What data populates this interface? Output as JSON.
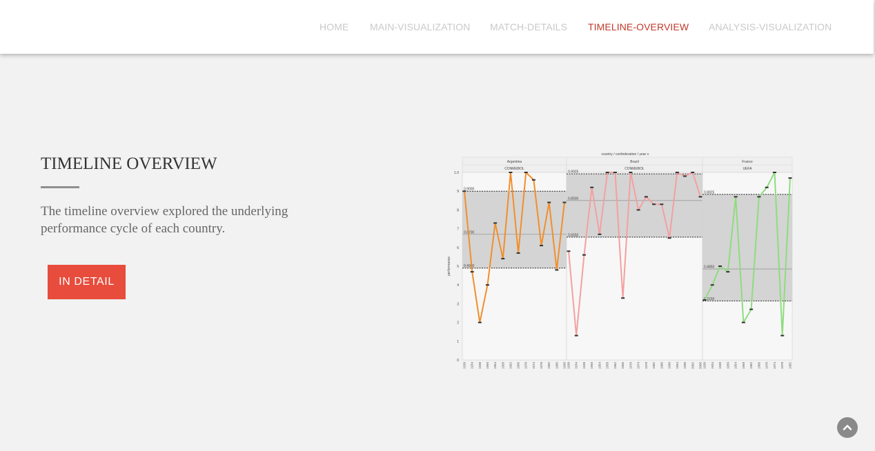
{
  "nav": {
    "items": [
      {
        "label": "HOME",
        "active": false
      },
      {
        "label": "MAIN-VISUALIZATION",
        "active": false
      },
      {
        "label": "MATCH-DETAILS",
        "active": false
      },
      {
        "label": "TIMELINE-OVERVIEW",
        "active": true
      },
      {
        "label": "ANALYSIS-VISUALIZATION",
        "active": false
      }
    ]
  },
  "section": {
    "title": "TIMELINE OVERVIEW",
    "description": "The timeline overview explored the underlying performance cycle of each country.",
    "button_label": "IN DETAIL"
  },
  "colors": {
    "accent": "#e74c3c",
    "nav_active": "#c0392b",
    "nav_inactive": "#c9c9c9",
    "background": "#f2f2f2"
  },
  "icons": {
    "scroll_top": "chevron-up-icon"
  },
  "chart_data": {
    "type": "line",
    "header": "country / confederation / year",
    "ylabel": "performance",
    "ylim": [
      0,
      10
    ],
    "yticks": [
      "0",
      "1",
      "2",
      "3",
      "4",
      "5",
      "6",
      "7",
      "8",
      "9",
      "1.0"
    ],
    "x": [
      "1930",
      "1934",
      "1938",
      "1950",
      "1954",
      "1958",
      "1962",
      "1966",
      "1970",
      "1974",
      "1978",
      "1982",
      "1986",
      "1990",
      "1994",
      "1998",
      "2002",
      "2006"
    ],
    "panels": [
      {
        "country": "Argentina",
        "confederation": "CONMEBOL",
        "color": "#f28e2b",
        "values": [
          9.0,
          4.7,
          2.0,
          4.0,
          7.3,
          5.4,
          10.0,
          5.7,
          10.0,
          9.6,
          6.1,
          8.4,
          4.8,
          8.4
        ],
        "band_labels": [
          "0.9000",
          "0.6700",
          "0.4900"
        ],
        "band": [
          4.9,
          9.0
        ],
        "mid": 6.7
      },
      {
        "country": "Brazil",
        "confederation": "CONMEBOL",
        "color": "#f4a0a0",
        "values": [
          5.8,
          1.3,
          5.6,
          9.2,
          6.7,
          10.0,
          10.0,
          3.3,
          10.0,
          8.0,
          8.7,
          8.3,
          8.3,
          6.5,
          10.0,
          9.8,
          10.0,
          8.7
        ],
        "band_labels": [
          "0.9925",
          "0.8500",
          "0.6550"
        ],
        "band": [
          6.55,
          9.92
        ],
        "mid": 8.5
      },
      {
        "country": "France",
        "confederation": "UEFA",
        "color": "#8fdc7f",
        "values": [
          3.2,
          4.0,
          5.0,
          4.7,
          8.7,
          2.0,
          2.7,
          8.7,
          9.2,
          10.0,
          1.3,
          9.7
        ],
        "band_labels": [
          "0.8825",
          "0.4850",
          "0.3150"
        ],
        "band": [
          3.15,
          8.83
        ],
        "mid": 4.85
      }
    ]
  }
}
